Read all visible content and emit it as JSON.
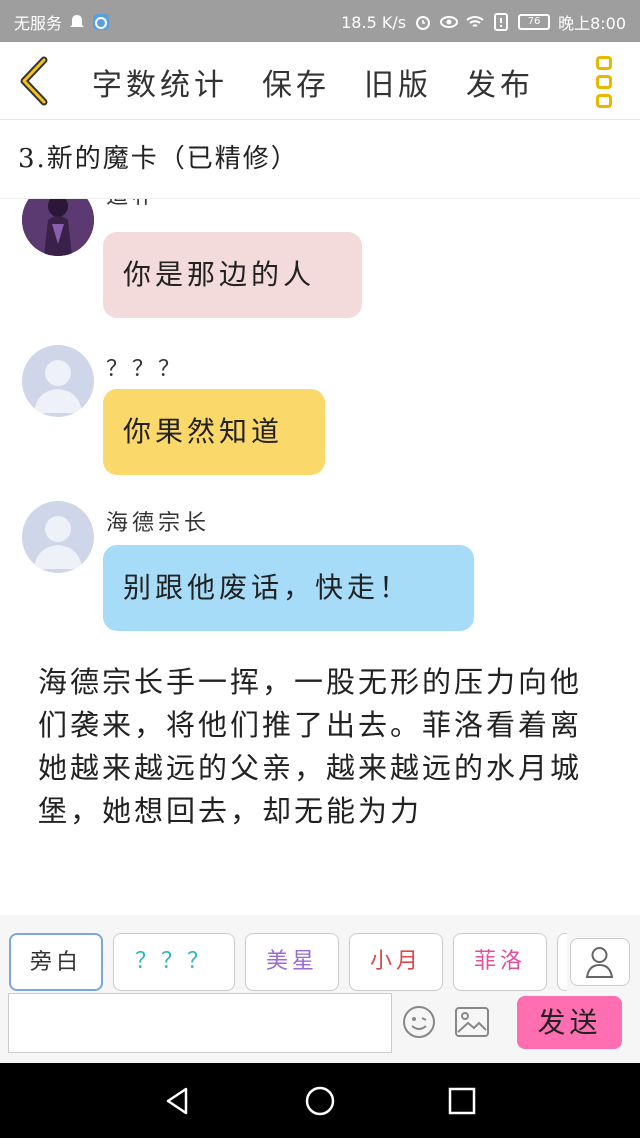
{
  "status_bar": {
    "carrier": "无服务",
    "speed": "18.5 K/s",
    "battery": "76",
    "time": "晚上8:00"
  },
  "toolbar": {
    "items": [
      {
        "label": "字数统计"
      },
      {
        "label": "保存"
      },
      {
        "label": "旧版"
      },
      {
        "label": "发布"
      }
    ]
  },
  "chapter": {
    "title": "3.新的魔卡（已精修）"
  },
  "messages": [
    {
      "speaker": "追朴",
      "text": "你是那边的人",
      "bubble_color": "#f3dadb"
    },
    {
      "speaker": "？？？",
      "text": "你果然知道",
      "bubble_color": "#fbd86a"
    },
    {
      "speaker": "海德宗长",
      "text": "别跟他废话，快走！",
      "bubble_color": "#a7dcf8"
    }
  ],
  "narration": "海德宗长手一挥，一股无形的压力向他们袭来，将他们推了出去。菲洛看着离她越来越远的父亲，越来越远的水月城堡，她想回去，却无能为力",
  "characters": [
    {
      "label": "旁白",
      "color": "#333333",
      "selected": true
    },
    {
      "label": "？？？",
      "color": "#2bb5c4",
      "selected": false
    },
    {
      "label": "美星",
      "color": "#9a6ad6",
      "selected": false
    },
    {
      "label": "小月",
      "color": "#e04848",
      "selected": false
    },
    {
      "label": "菲洛",
      "color": "#e0509e",
      "selected": false
    }
  ],
  "input": {
    "placeholder": "",
    "send_label": "发送"
  },
  "colors": {
    "accent_yellow": "#e6b800",
    "send_pink": "#ff6eb0"
  }
}
